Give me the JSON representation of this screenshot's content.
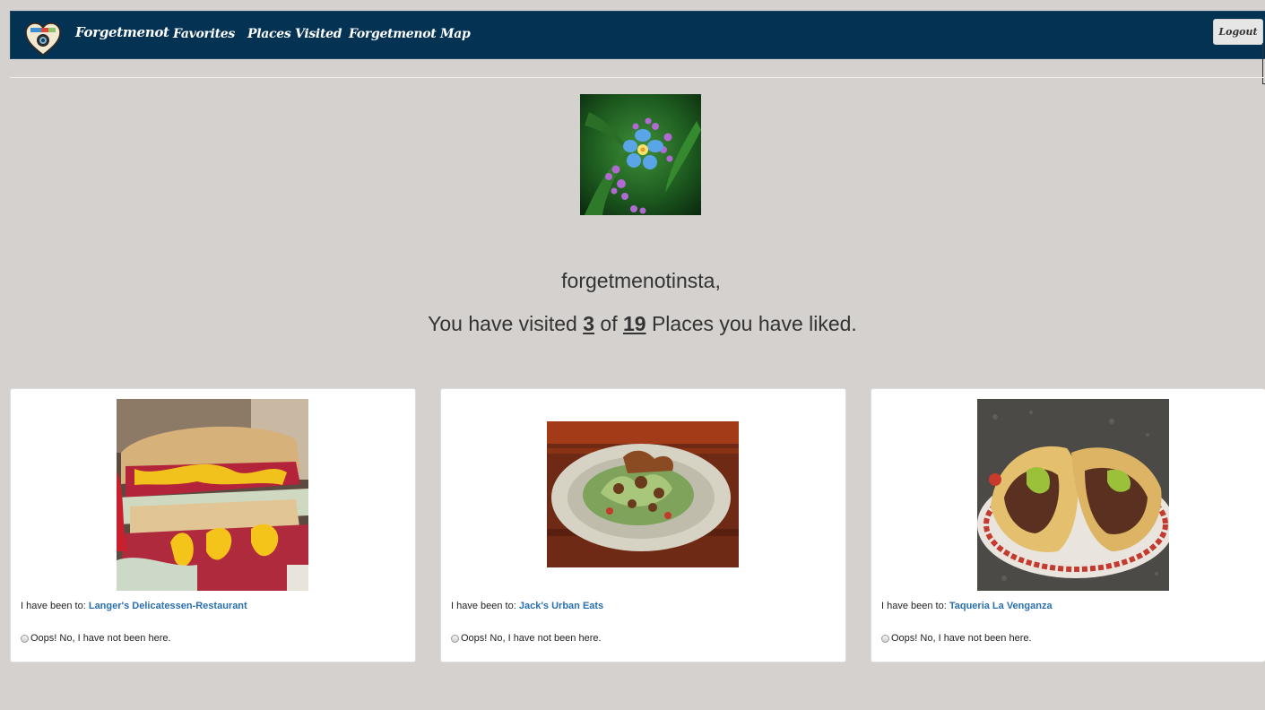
{
  "navbar": {
    "brand": "Forgetmenot",
    "links": [
      "Favorites",
      "Places Visited",
      "Forgetmenot Map"
    ],
    "logout_label": "Logout",
    "background": "#033253"
  },
  "profile": {
    "username_line": "forgetmenotinsta,",
    "summary_prefix": "You have visited",
    "visited_count": "3",
    "summary_of": "of",
    "liked_count": "19",
    "summary_suffix": "Places you have liked."
  },
  "cards": [
    {
      "caption_prefix": "I have been to:",
      "place_name": "Langer's Delicatessen-Restaurant",
      "radio_label": "Oops! No, I have not been here.",
      "image": "sandwich-photo"
    },
    {
      "caption_prefix": "I have been to:",
      "place_name": "Jack's Urban Eats",
      "radio_label": "Oops! No, I have not been here.",
      "image": "salad-photo"
    },
    {
      "caption_prefix": "I have been to:",
      "place_name": "Taqueria La Venganza",
      "radio_label": "Oops! No, I have not been here.",
      "image": "tacos-photo"
    }
  ],
  "colors": {
    "page_background": "#d5d1ce",
    "link": "#2a6fb0"
  }
}
